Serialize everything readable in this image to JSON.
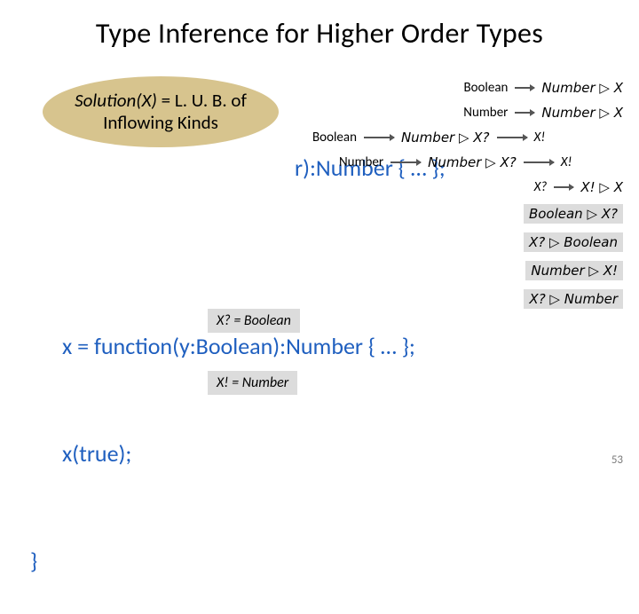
{
  "title": "Type Inference for Higher Order Types",
  "bubble": {
    "line1_pre": "Solution(X)",
    "line1_post": " = L. U. B. of",
    "line2": "Inflowing Kinds"
  },
  "code": {
    "l1_tail": "r):Number { … };",
    "l2": "",
    "l3": "x = function(y:Boolean):Number { … };",
    "l4": "x(true);",
    "l5": "}"
  },
  "tokens": {
    "bool": "Boolean",
    "num": "Number",
    "numx": "Number ▷ X",
    "numxq": "Number ▷ X?",
    "xbang": "X!",
    "xq": "X?",
    "xbangx": "X! ▷ X",
    "boolxq": "Boolean ▷ X?",
    "xqbool": "X? ▷ Boolean",
    "numxbang": "Number ▷ X!",
    "xqnum": "X? ▷ Number"
  },
  "solutions": {
    "xq": "X? = Boolean",
    "xbang": "X! = Number"
  },
  "page": "53"
}
